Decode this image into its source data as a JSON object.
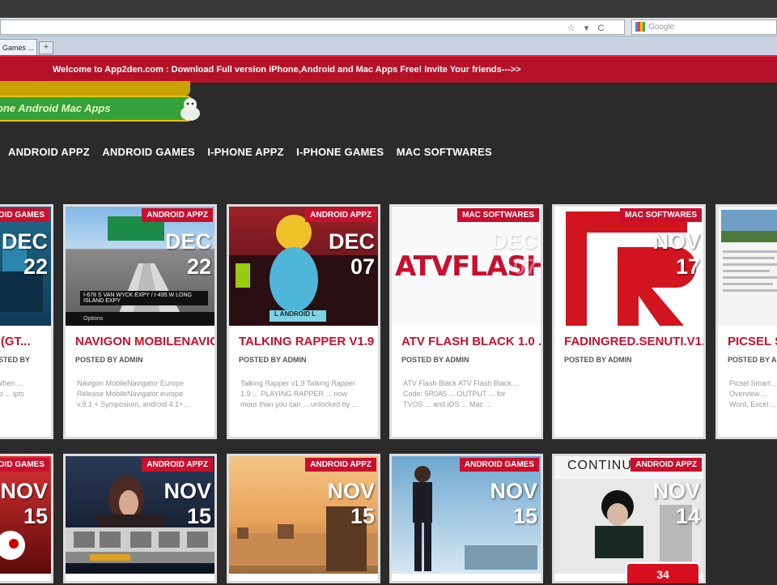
{
  "browser": {
    "tab_label": "Games ...",
    "new_tab": "+",
    "search_placeholder": "Google",
    "url_icons": "☆ ▾ C"
  },
  "banner": {
    "text": "Welcome to App2den.com : Download Full version iPhone,Android and Mac Apps Free! Invite Your friends--->>"
  },
  "logo": {
    "text": "one   Android   Mac Apps"
  },
  "nav": {
    "items": [
      "ANDROID APPZ",
      "ANDROID GAMES",
      "I-PHONE APPZ",
      "I-PHONE GAMES",
      "MAC SOFTWARES"
    ]
  },
  "row1": [
    {
      "category": "ANDROID GAMES",
      "month": "DEC",
      "day": "22",
      "title": "O (GT...",
      "posted": "POSTED BY",
      "excerpt": "... When ... Auto ... ipts"
    },
    {
      "category": "ANDROID APPZ",
      "month": "DEC",
      "day": "22",
      "title": "NAVIGON MOBILENAVIGA...",
      "posted": "POSTED BY ADMIN",
      "excerpt": "Navigon MobileNavigator Europe Release MobileNavigator europe v.9.1 + Symposium, android 4.1+..."
    },
    {
      "category": "ANDROID APPZ",
      "month": "DEC",
      "day": "07",
      "title": "TALKING RAPPER V1.9 ...",
      "posted": "POSTED BY ADMIN",
      "excerpt": "Talking Rapper v1.9 Talking Rapper 1.9 ... PLAYING RAPPER ... now more than you can ... unlocked by ..."
    },
    {
      "category": "MAC SOFTWARES",
      "month": "DEC",
      "day": "07",
      "title": "ATV FLASH BLACK 1.0 ...",
      "posted": "POSTED BY ADMIN",
      "excerpt": "ATV Flash Black ATV Flash Black ... Code: 5R0A5 ... OUTPUT ... for TVOS ... and iOS ... Mac ..."
    },
    {
      "category": "MAC SOFTWARES",
      "month": "NOV",
      "day": "17",
      "title": "FADINGRED.SENUTI.V1...",
      "posted": "POSTED BY ADMIN",
      "excerpt": ""
    },
    {
      "category": "",
      "month": "",
      "day": "",
      "title": "PICSEL SM...",
      "posted": "POSTED BY ADM",
      "excerpt": "Picsel Smart ... Overview ... Word, Excel ..."
    }
  ],
  "row2": [
    {
      "category": "ANDROID GAMES",
      "month": "NOV",
      "day": "15"
    },
    {
      "category": "ANDROID APPZ",
      "month": "NOV",
      "day": "15"
    },
    {
      "category": "ANDROID APPZ",
      "month": "NOV",
      "day": "15"
    },
    {
      "category": "ANDROID GAMES",
      "month": "NOV",
      "day": "15"
    },
    {
      "category": "ANDROID APPZ",
      "month": "NOV",
      "day": "14"
    }
  ],
  "thumb_text": {
    "atv": "ATVFLASH",
    "road_sign": "I-678 S VAN WYCK EXPY / I-495 W LONG ISLAND EXPY",
    "nav_buttons": "Options",
    "continue": "CONTINU",
    "rapper_sign": "L ANDROID L"
  },
  "counter": "34",
  "colors": {
    "accent": "#c8102e",
    "background": "#2b2b2b",
    "banner": "#b5122a"
  }
}
